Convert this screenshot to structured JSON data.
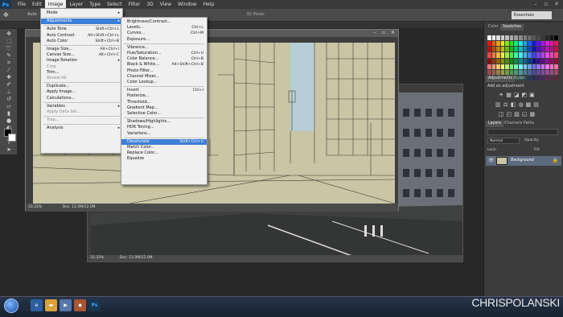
{
  "app": {
    "logo": "Ps"
  },
  "menubar": {
    "items": [
      "File",
      "Edit",
      "Image",
      "Layer",
      "Type",
      "Select",
      "Filter",
      "3D",
      "View",
      "Window",
      "Help"
    ]
  },
  "options_bar": {
    "auto_label": "Auto",
    "mode_3d": "3D Mode:"
  },
  "workspace": {
    "value": "Essentials"
  },
  "document_front": {
    "zoom": "33.33%",
    "doc_info": "Doc: 12.0M/12.0M"
  },
  "document_back": {
    "zoom": "33.33%",
    "doc_info": "Doc: 12.0M/12.0M"
  },
  "image_menu": [
    {
      "label": "Mode",
      "submenu": true
    },
    {
      "sep": true
    },
    {
      "label": "Adjustments",
      "submenu": true,
      "highlighted": true
    },
    {
      "sep": true
    },
    {
      "label": "Auto Tone",
      "shortcut": "Shift+Ctrl+L"
    },
    {
      "label": "Auto Contrast",
      "shortcut": "Alt+Shift+Ctrl+L"
    },
    {
      "label": "Auto Color",
      "shortcut": "Shift+Ctrl+B"
    },
    {
      "sep": true
    },
    {
      "label": "Image Size...",
      "shortcut": "Alt+Ctrl+I"
    },
    {
      "label": "Canvas Size...",
      "shortcut": "Alt+Ctrl+C"
    },
    {
      "label": "Image Rotation",
      "submenu": true
    },
    {
      "label": "Crop",
      "disabled": true
    },
    {
      "label": "Trim..."
    },
    {
      "label": "Reveal All",
      "disabled": true
    },
    {
      "sep": true
    },
    {
      "label": "Duplicate..."
    },
    {
      "label": "Apply Image..."
    },
    {
      "label": "Calculations..."
    },
    {
      "sep": true
    },
    {
      "label": "Variables",
      "submenu": true
    },
    {
      "label": "Apply Data Set...",
      "disabled": true
    },
    {
      "sep": true
    },
    {
      "label": "Trap...",
      "disabled": true
    },
    {
      "sep": true
    },
    {
      "label": "Analysis",
      "submenu": true
    }
  ],
  "adjustments_menu": [
    {
      "label": "Brightness/Contrast..."
    },
    {
      "label": "Levels...",
      "shortcut": "Ctrl+L"
    },
    {
      "label": "Curves...",
      "shortcut": "Ctrl+M"
    },
    {
      "label": "Exposure..."
    },
    {
      "sep": true
    },
    {
      "label": "Vibrance..."
    },
    {
      "label": "Hue/Saturation...",
      "shortcut": "Ctrl+U"
    },
    {
      "label": "Color Balance...",
      "shortcut": "Ctrl+B"
    },
    {
      "label": "Black & White...",
      "shortcut": "Alt+Shift+Ctrl+B"
    },
    {
      "label": "Photo Filter..."
    },
    {
      "label": "Channel Mixer..."
    },
    {
      "label": "Color Lookup..."
    },
    {
      "sep": true
    },
    {
      "label": "Invert",
      "shortcut": "Ctrl+I"
    },
    {
      "label": "Posterize..."
    },
    {
      "label": "Threshold..."
    },
    {
      "label": "Gradient Map..."
    },
    {
      "label": "Selective Color..."
    },
    {
      "sep": true
    },
    {
      "label": "Shadows/Highlights..."
    },
    {
      "label": "HDR Toning..."
    },
    {
      "label": "Variations..."
    },
    {
      "sep": true
    },
    {
      "label": "Desaturate",
      "shortcut": "Shift+Ctrl+U",
      "highlighted": true
    },
    {
      "label": "Match Color..."
    },
    {
      "label": "Replace Color..."
    },
    {
      "label": "Equalize"
    }
  ],
  "panels": {
    "color_tabs": [
      "Color",
      "Swatches"
    ],
    "adj_tabs": [
      "Adjustments",
      "Styles"
    ],
    "adj_hint": "Add an adjustment",
    "layer_tabs": [
      "Layers",
      "Channels",
      "Paths"
    ],
    "blend_mode": "Normal",
    "opacity_label": "Opacity:",
    "lock_label": "Lock:",
    "fill_label": "Fill:",
    "layer_name": "Background"
  },
  "watermark": "CHRISPOLANSKI",
  "colors": {
    "menu_highlight": "#3b7fd8",
    "canvas_beige": "#c9c5a5",
    "accent": "#31a8ff"
  }
}
